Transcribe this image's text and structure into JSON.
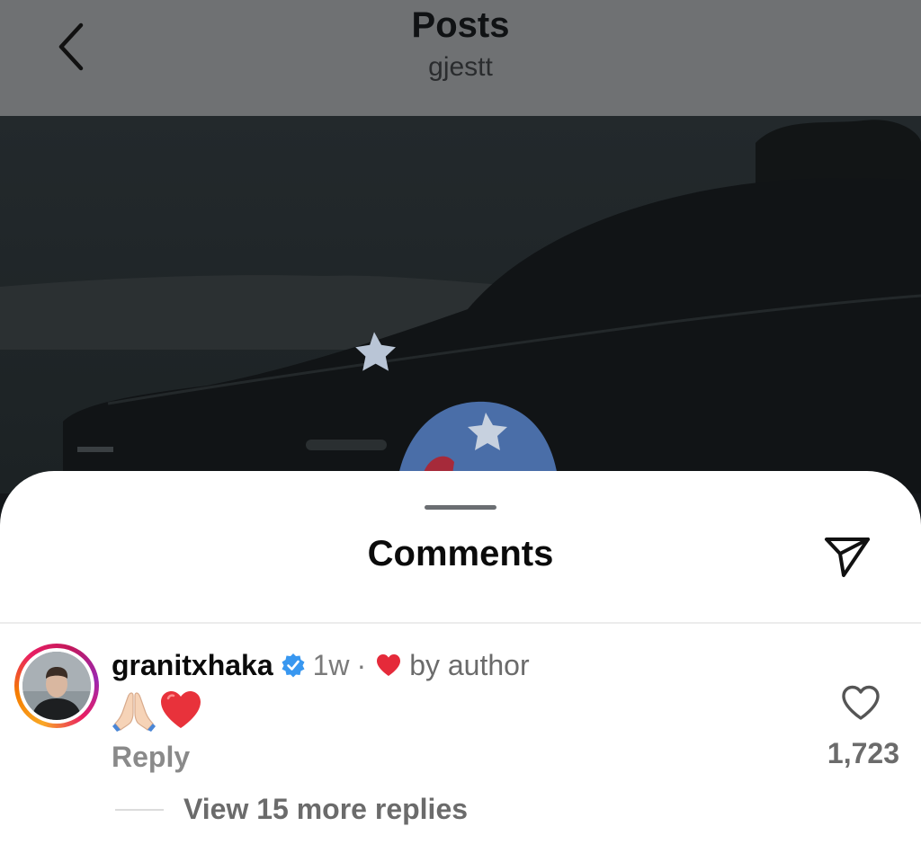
{
  "header": {
    "title": "Posts",
    "subtitle": "gjestt",
    "back_icon": "chevron-left-icon",
    "background_color": "#6f7173"
  },
  "post_photo": {
    "description_tint": "#1a1e20"
  },
  "comments_sheet": {
    "title": "Comments",
    "send_icon": "paper-plane-icon"
  },
  "comment": {
    "username": "granitxhaka",
    "verified": true,
    "verified_color": "#3897f0",
    "time": "1w",
    "separator": "·",
    "liked_by_author_label": "by author",
    "liked_heart_color": "#e52a3a",
    "body_emojis": [
      "folded-hands-emoji",
      "red-heart-emoji"
    ],
    "reply_label": "Reply",
    "like_count": "1,723",
    "like_icon": "heart-outline-icon",
    "view_more_label": "View 15 more replies"
  }
}
